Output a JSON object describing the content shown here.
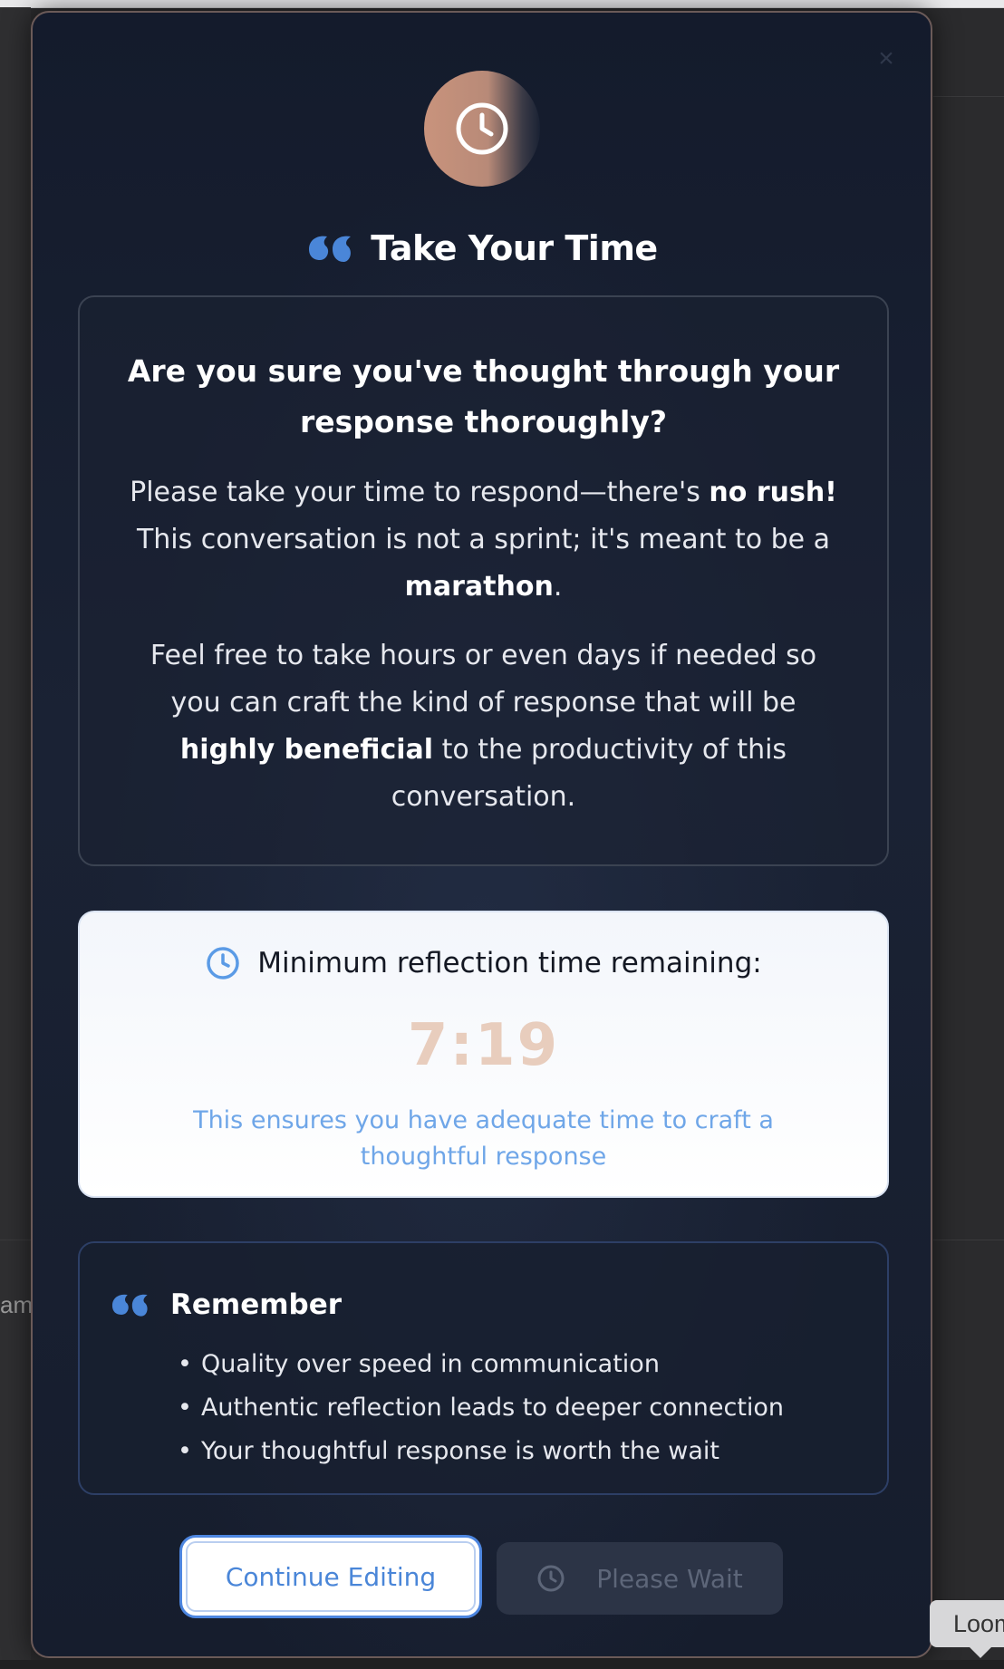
{
  "background": {
    "left_partial_text": "am",
    "tooltip_text": "Loom"
  },
  "modal": {
    "close_label": "×",
    "title": "Take Your Time",
    "question": "Are you sure you've thought through your response thoroughly?",
    "para1": {
      "a": "Please take your time to respond—there's ",
      "b_bold": "no rush!",
      "c": " This conversation is not a sprint; it's meant to be a ",
      "d_bold": "marathon",
      "e": "."
    },
    "para2": {
      "a": "Feel free to take hours or even days if needed so you can craft the kind of response that will be ",
      "b_bold": "highly beneficial",
      "c": " to the productivity of this conversation."
    },
    "timer_box": {
      "label": "Minimum reflection time remaining:",
      "time": "7:19",
      "note": "This ensures you have adequate time to craft a thoughtful response"
    },
    "remember": {
      "heading": "Remember",
      "items": [
        "Quality over speed in communication",
        "Authentic reflection leads to deeper connection",
        "Your thoughtful response is worth the wait"
      ]
    },
    "buttons": {
      "continue_label": "Continue Editing",
      "wait_label": "Please Wait"
    }
  },
  "colors": {
    "accent_blue": "#4a86d8",
    "timer_peach": "#e8cdbd",
    "modal_bg": "#161d2d"
  }
}
